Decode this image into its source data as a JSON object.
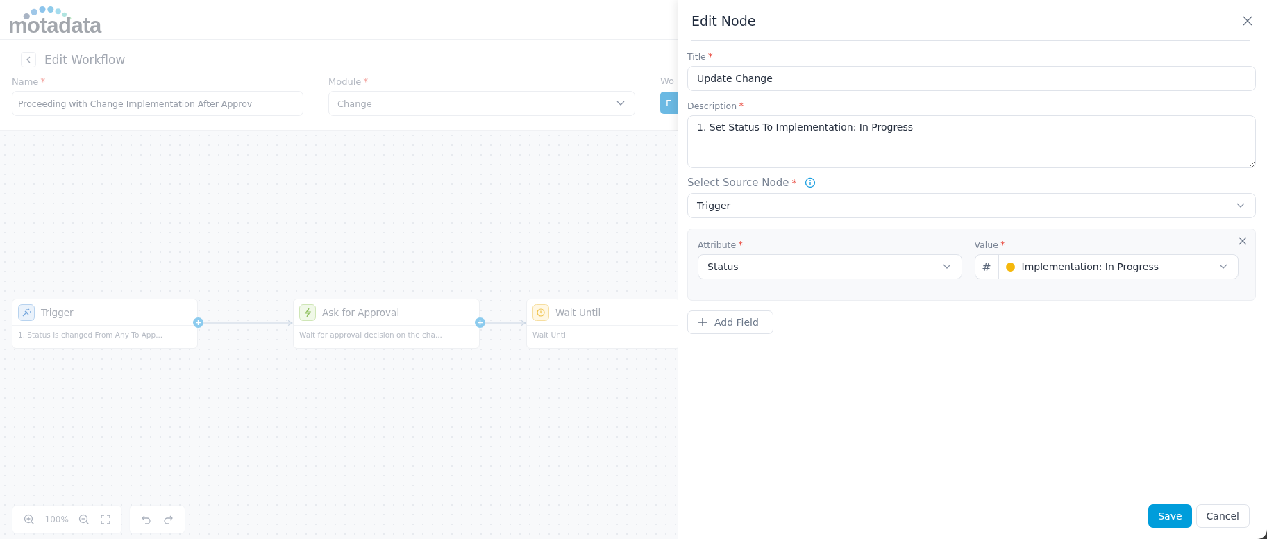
{
  "app": {
    "logo": "motadata"
  },
  "page": {
    "title": "Edit Workflow"
  },
  "form": {
    "fields": [
      {
        "kind": "text",
        "label": "Name",
        "required_mark": "*",
        "value": "Proceeding with Change Implementation After Approv"
      },
      {
        "kind": "select",
        "label": "Module",
        "required_mark": "*",
        "value": "Change"
      },
      {
        "kind": "button",
        "label": "Wo",
        "value": "E"
      }
    ]
  },
  "canvas": {
    "nodes": [
      {
        "kind": "trigger",
        "title": "Trigger",
        "description": "1. Status is changed From Any To App..."
      },
      {
        "kind": "approval",
        "title": "Ask for Approval",
        "description": "Wait for approval decision on the cha..."
      },
      {
        "kind": "wait",
        "title": "Wait Until",
        "description": "Wait Until"
      }
    ],
    "zoom": "100%"
  },
  "panel": {
    "title": "Edit Node",
    "title_field": {
      "label": "Title",
      "required_mark": "*",
      "value": "Update Change"
    },
    "description_field": {
      "label": "Description",
      "required_mark": "*",
      "value": "1. Set Status To Implementation: In Progress"
    },
    "source_field": {
      "label": "Select Source Node",
      "required_mark": "*",
      "value": "Trigger"
    },
    "conditions": [
      {
        "attribute_label": "Attribute",
        "attribute_mark": "*",
        "attribute": "Status",
        "value_label": "Value",
        "value_mark": "*",
        "value_prefix": "#",
        "value": "Implementation: In Progress",
        "color": "#f5b80c"
      }
    ],
    "add_button": "Add Field",
    "buttons": [
      {
        "kind": "primary",
        "label": "Save"
      },
      {
        "kind": "secondary",
        "label": "Cancel"
      }
    ]
  }
}
